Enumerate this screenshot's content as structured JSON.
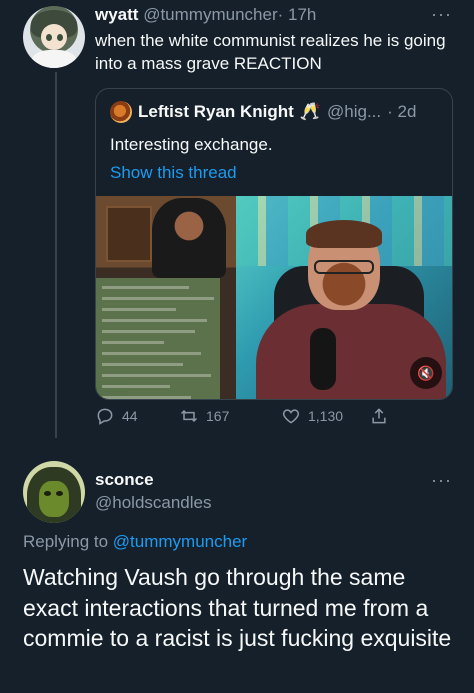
{
  "colors": {
    "background": "#15202b",
    "text": "#f7f9f9",
    "secondary": "#8b98a5",
    "link": "#1d9bf0",
    "border": "#38444d"
  },
  "tweet1": {
    "name": "wyatt",
    "handle": "@tummymuncher",
    "time": "· 17h",
    "text": "when the white communist realizes he is going into a mass grave REACTION",
    "more": "···",
    "avatar_icon": "anime-girl-avatar",
    "quote": {
      "name": "Leftist Ryan Knight",
      "emoji": "🥂",
      "handle": "@hig...",
      "time": "· 2d",
      "text": "Interesting exchange.",
      "link": "Show this thread",
      "media": {
        "type": "video",
        "mute_icon": "volume-mute-icon",
        "mute_label": "🔇"
      }
    },
    "actions": {
      "replies": "44",
      "retweets": "167",
      "likes": "1,130"
    }
  },
  "tweet2": {
    "name": "sconce",
    "handle": "@holdscandles",
    "more": "···",
    "avatar_icon": "green-hooded-figure-avatar",
    "replying_prefix": "Replying to",
    "replying_to": "@tummymuncher",
    "text": "Watching Vaush go through the same exact interactions that turned me from a commie to a racist is just fucking exquisite"
  }
}
